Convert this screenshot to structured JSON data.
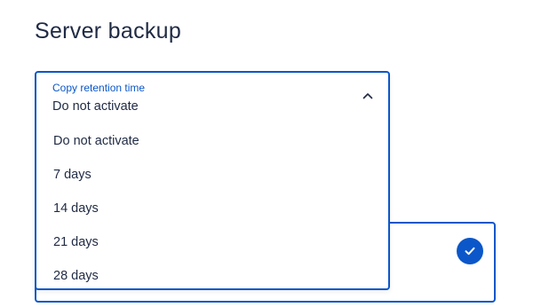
{
  "page": {
    "title": "Server backup"
  },
  "retention_select": {
    "label": "Copy retention time",
    "selected_value": "Do not activate",
    "chevron_icon": "chevron-up-icon",
    "options": [
      "Do not activate",
      "7 days",
      "14 days",
      "21 days",
      "28 days"
    ]
  },
  "option_card": {
    "check_icon": "checkmark-icon",
    "state": "selected"
  },
  "colors": {
    "accent": "#0b57c9",
    "text": "#1f2a44",
    "background": "#ffffff"
  }
}
